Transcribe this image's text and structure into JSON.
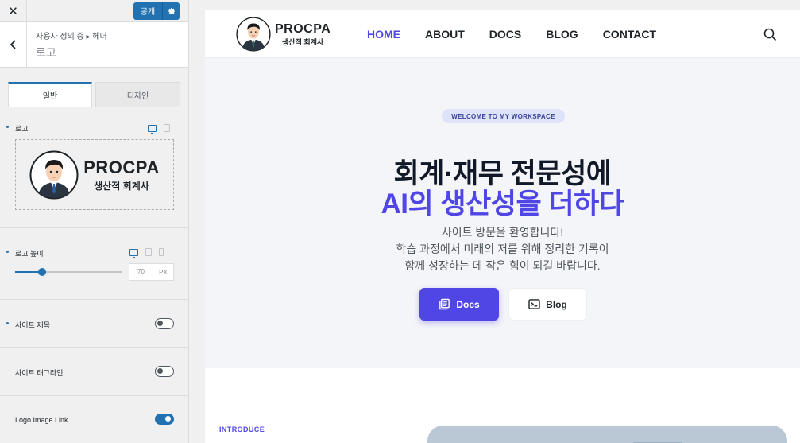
{
  "sidebar": {
    "close_icon": "close-icon",
    "publish_label": "공개",
    "breadcrumb": "사용자 정의 중 ▸ 헤더",
    "section_title": "로고",
    "tabs": [
      {
        "label": "일반",
        "active": true
      },
      {
        "label": "디자인",
        "active": false
      }
    ],
    "controls": {
      "logo_label": "로고",
      "logo_height_label": "로고 높이",
      "logo_height_value": "70",
      "logo_height_unit": "PX",
      "logo_height_slider_fraction": 0.25,
      "site_title_label": "사이트 제목",
      "site_title_on": false,
      "tagline_label": "사이트 태그라인",
      "tagline_on": false,
      "logo_link_label": "Logo Image Link",
      "logo_link_on": true
    }
  },
  "logo": {
    "brand": "PROCPA",
    "subtitle": "생산적 회계사"
  },
  "site": {
    "nav": [
      {
        "label": "HOME",
        "active": true
      },
      {
        "label": "ABOUT",
        "active": false
      },
      {
        "label": "DOCS",
        "active": false
      },
      {
        "label": "BLOG",
        "active": false
      },
      {
        "label": "CONTACT",
        "active": false
      }
    ],
    "hero": {
      "badge": "WELCOME TO MY WORKSPACE",
      "title_line1": "회계·재무 전문성에",
      "title_line2": "AI의 생산성을 더하다",
      "desc_line1": "사이트 방문을 환영합니다!",
      "desc_line2": "학습 과정에서 미래의 저를 위해 정리한 기록이",
      "desc_line3": "함께 성장하는 데 작은 힘이 되길 바랍니다.",
      "btn_docs": "Docs",
      "btn_blog": "Blog"
    },
    "introduce_label": "INTRODUCE"
  },
  "colors": {
    "wp_blue": "#2271b1",
    "accent": "#4f46e5"
  }
}
